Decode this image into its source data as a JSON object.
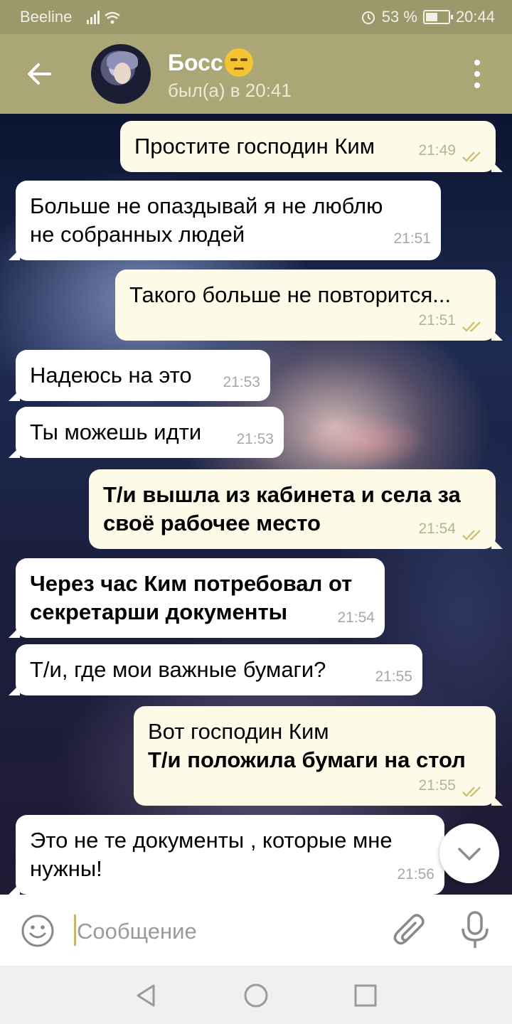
{
  "status_bar": {
    "carrier": "Beeline",
    "battery": "53 %",
    "battery_level": 0.53,
    "time": "20:44"
  },
  "header": {
    "contact_name": "Босс",
    "last_seen": "был(а) в 20:41",
    "status_emoji": "unamused-face-emoji"
  },
  "messages": [
    {
      "direction": "out",
      "text": "Простите господин Ким",
      "time": "21:49",
      "read": true
    },
    {
      "direction": "in",
      "lines": [
        "Больше не опаздывай я не люблю",
        "не собранных людей"
      ],
      "time": "21:51"
    },
    {
      "direction": "out",
      "text": "Такого больше не повторится...",
      "time": "21:51",
      "read": true
    },
    {
      "direction": "in",
      "text": "Надеюсь на это",
      "time": "21:53"
    },
    {
      "direction": "in",
      "text": "Ты можешь идти",
      "time": "21:53"
    },
    {
      "direction": "out",
      "bold": true,
      "lines": [
        "Т/и вышла из кабинета и села за",
        "своё рабочее место"
      ],
      "time": "21:54",
      "read": true
    },
    {
      "direction": "in",
      "bold": true,
      "lines": [
        "Через час Ким потребовал от",
        "секретарши документы"
      ],
      "time": "21:54"
    },
    {
      "direction": "in",
      "text": "Т/и, где мои важные бумаги?",
      "time": "21:55"
    },
    {
      "direction": "out",
      "lines": [
        "Вот господин Ким",
        "Т/и положила бумаги на стол"
      ],
      "bold_line_index": 1,
      "time": "21:55",
      "read": true
    },
    {
      "direction": "in",
      "lines": [
        "Это не те документы , которые мне",
        "нужны!"
      ],
      "time": "21:56"
    }
  ],
  "input": {
    "placeholder": "Сообщение"
  },
  "colors": {
    "header": "#aaa676",
    "status_bar": "#9b986b",
    "outgoing_bubble": "#fdfae8",
    "incoming_bubble": "#ffffff",
    "read_ticks": "#c9bd6a"
  },
  "icons": [
    "back-arrow-icon",
    "more-vertical-icon",
    "double-check-icon",
    "chevron-down-icon",
    "smiley-icon",
    "paperclip-icon",
    "microphone-icon",
    "nav-back-icon",
    "nav-home-icon",
    "nav-recents-icon"
  ]
}
